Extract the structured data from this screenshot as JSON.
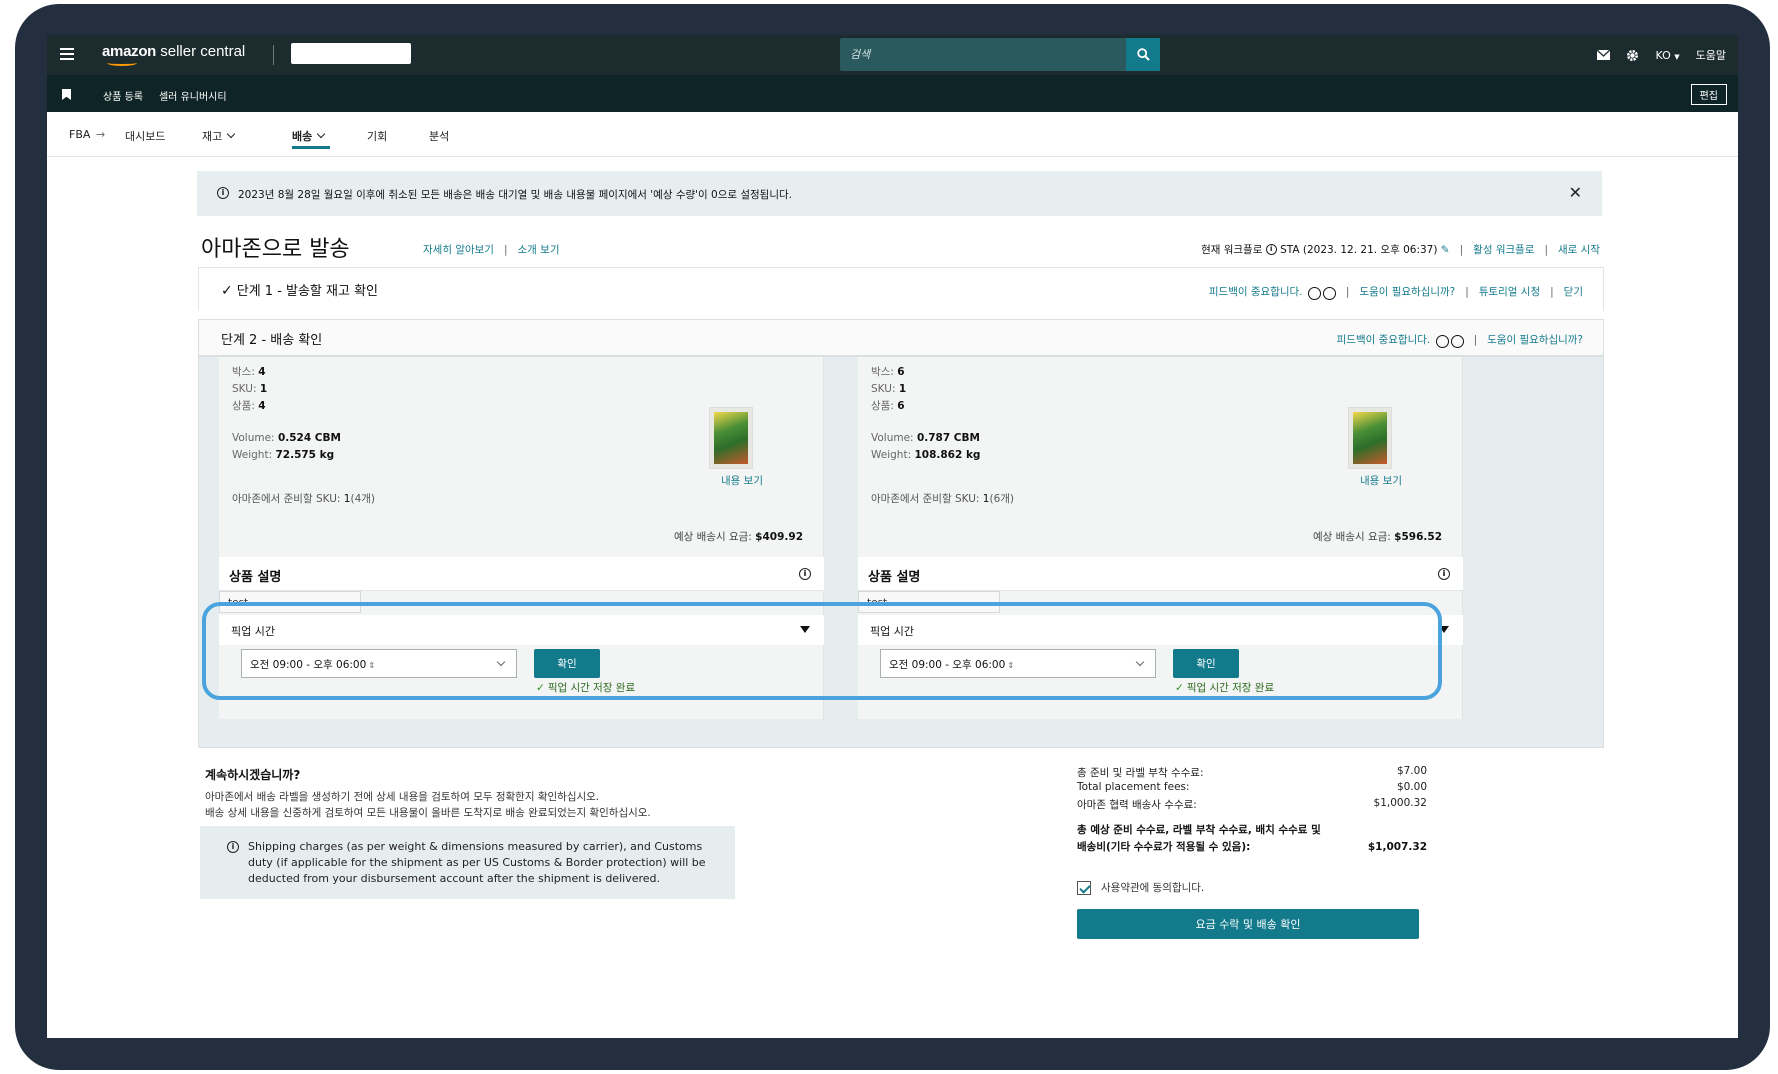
{
  "topbar": {
    "logo_bold": "amazon",
    "logo_rest": " seller central",
    "search_placeholder": "검색",
    "lang": "KO",
    "help": "도움말"
  },
  "secbar": {
    "links": [
      "상품 등록",
      "셀러 유니버시티"
    ],
    "edit": "편집"
  },
  "nav": {
    "fba": "FBA",
    "items": [
      "대시보드",
      "재고",
      "배송",
      "기회",
      "분석"
    ],
    "active": "배송"
  },
  "alert": {
    "text": "2023년 8월 28일 월요일 이후에 취소된 모든 배송은 배송 대기열 및 배송 내용물 페이지에서 '예상 수량'이 0으로 설정됩니다."
  },
  "header": {
    "title": "아마존으로 발송",
    "learn_more": "자세히 알아보기",
    "intro": "소개 보기",
    "workflow_label": "현재 워크플로",
    "workflow_value": "STA (2023. 12. 21. 오후 06:37)",
    "active_workflow": "활성 워크플로",
    "restart": "새로 시작"
  },
  "step1": {
    "title": "단계 1 - 발송할 재고 확인",
    "feedback": "피드백이 중요합니다.",
    "need_help": "도움이 필요하십니까?",
    "tutorial": "튜토리얼 시청",
    "close": "닫기"
  },
  "step2": {
    "title": "단계 2 - 배송 확인",
    "feedback": "피드백이 중요합니다.",
    "need_help": "도움이 필요하십니까?"
  },
  "labels": {
    "box": "박스:",
    "sku": "SKU:",
    "product": "상품:",
    "volume": "Volume:",
    "weight": "Weight:",
    "view": "내용 보기",
    "prep_sku": "아마존에서 준비할 SKU:",
    "est_fee": "예상 배송시 요금:",
    "desc_title": "상품 설명",
    "pickup_title": "픽업 시간",
    "confirm": "확인",
    "saved": "픽업 시간 저장 완료"
  },
  "cards": [
    {
      "box": "4",
      "sku": "1",
      "product": "4",
      "volume": "0.524 CBM",
      "weight": "72.575 kg",
      "prep_sku_count": "1",
      "prep_sku_units": "(4개)",
      "fee": "$409.92",
      "desc": "test",
      "pickup_time": "오전 09:00 - 오후 06:00"
    },
    {
      "box": "6",
      "sku": "1",
      "product": "6",
      "volume": "0.787 CBM",
      "weight": "108.862 kg",
      "prep_sku_count": "1",
      "prep_sku_units": "(6개)",
      "fee": "$596.52",
      "desc": "test",
      "pickup_time": "오전 09:00 - 오후 06:00"
    }
  ],
  "bottom": {
    "continue_title": "계속하시겠습니까?",
    "continue_l1": "아마존에서 배송 라벨을 생성하기 전에 상세 내용을 검토하여 모두 정확한지 확인하십시오.",
    "continue_l2": "배송 상세 내용을 신중하게 검토하여 모든 내용물이 올바른 도착지로 배송 완료되었는지 확인하십시오.",
    "note": "Shipping charges (as per weight & dimensions measured by carrier), and Customs duty (if applicable for the shipment as per US Customs & Border protection) will be deducted from your disbursement account after the shipment is delivered."
  },
  "fees": {
    "lines": [
      {
        "label": "총 준비 및 라벨 부착 수수료:",
        "value": "$7.00"
      },
      {
        "label": "Total placement fees:",
        "value": "$0.00"
      },
      {
        "label": "아마존 협력 배송사 수수료:",
        "value": "$1,000.32"
      }
    ],
    "total_l1": "총 예상 준비 수수료, 라벨 부착 수수료, 배치 수수료 및",
    "total_l2": "배송비(기타 수수료가 적용될 수 있음):",
    "total_value": "$1,007.32",
    "agree": "사용약관에 동의합니다.",
    "accept": "요금 수락 및 배송 확인"
  },
  "colors": {
    "teal": "#137a8c",
    "topbar": "#1c2b2d",
    "highlight": "#4aa3dc"
  }
}
